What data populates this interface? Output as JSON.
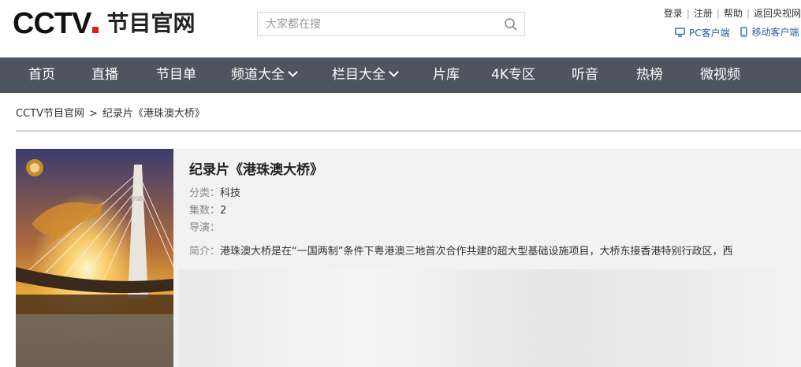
{
  "header": {
    "logo_text": "CCTV",
    "logo_sub": "节目官网",
    "search_placeholder": "大家都在搜",
    "links": [
      "登录",
      "注册",
      "帮助",
      "返回央视网"
    ],
    "pc_client": "PC客户端",
    "mobile_client": "移动客户端"
  },
  "nav": {
    "items": [
      {
        "label": "首页"
      },
      {
        "label": "直播"
      },
      {
        "label": "节目单"
      },
      {
        "label": "频道大全"
      },
      {
        "label": "栏目大全"
      },
      {
        "label": "片库"
      },
      {
        "label": "4K专区"
      },
      {
        "label": "听音"
      },
      {
        "label": "热榜"
      },
      {
        "label": "微视频"
      }
    ]
  },
  "breadcrumb": {
    "home": "CCTV节目官网",
    "sep": ">",
    "current": "纪录片《港珠澳大桥》"
  },
  "program": {
    "title": "纪录片《港珠澳大桥》",
    "category_label": "分类：",
    "category": "科技",
    "episodes_label": "集数：",
    "episodes": "2",
    "director_label": "导演：",
    "director": "",
    "intro_label": "简介：",
    "intro": "港珠澳大桥是在“一国两制”条件下粤港澳三地首次合作共建的超大型基础设施项目，大桥东接香港特别行政区，西"
  },
  "colors": {
    "nav_bg": "#4e5560",
    "logo_red": "#d61f1f",
    "link_blue": "#2461a6",
    "panel_bg": "#f2f2f2"
  }
}
